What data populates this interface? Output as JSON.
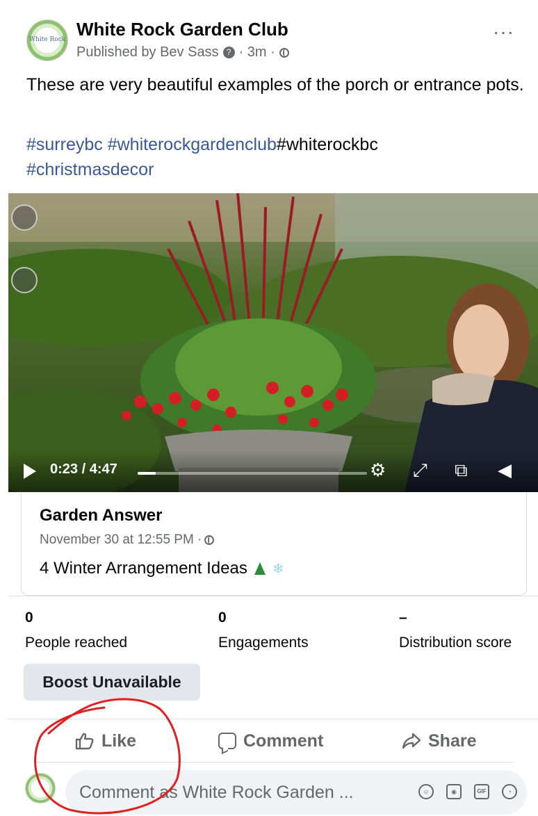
{
  "post": {
    "page_name": "White Rock Garden Club",
    "avatar_text": "White Rock",
    "published_by": "Published by Bev Sass",
    "time": "· 3m ·",
    "more_label": "···",
    "text": "These are very beautiful examples of the porch  or entrance pots.",
    "hashtags": [
      "#surreybc",
      "#whiterockgardenclub",
      "#whiterockbc",
      "#christmasdecor"
    ]
  },
  "video": {
    "timecode": "0:23 / 4:47",
    "progress": 0.08
  },
  "source": {
    "name": "Garden Answer",
    "date": "November 30 at 12:55 PM ·",
    "title": "4 Winter Arrangement Ideas"
  },
  "stats": [
    {
      "value": "0",
      "label": "People reached"
    },
    {
      "value": "0",
      "label": "Engagements"
    },
    {
      "value": "–",
      "label": "Distribution score"
    }
  ],
  "boost_label": "Boost Unavailable",
  "actions": {
    "like": "Like",
    "comment": "Comment",
    "share": "Share"
  },
  "comment_placeholder": "Comment as White Rock Garden ...",
  "colors": {
    "link": "#385898",
    "secondary_text": "#65676b",
    "annotation": "#e0201e"
  }
}
